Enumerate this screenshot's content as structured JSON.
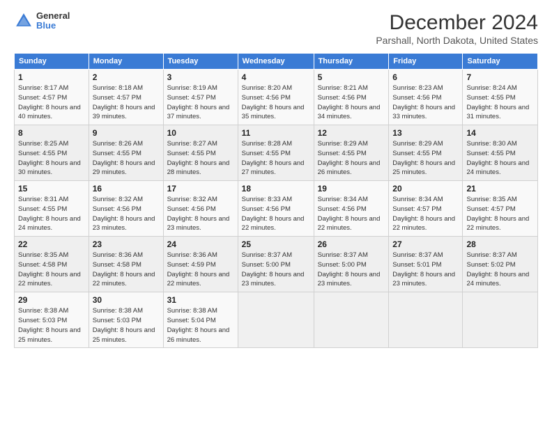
{
  "header": {
    "logo_general": "General",
    "logo_blue": "Blue",
    "month_title": "December 2024",
    "location": "Parshall, North Dakota, United States"
  },
  "weekdays": [
    "Sunday",
    "Monday",
    "Tuesday",
    "Wednesday",
    "Thursday",
    "Friday",
    "Saturday"
  ],
  "weeks": [
    [
      {
        "day": "1",
        "sunrise": "8:17 AM",
        "sunset": "4:57 PM",
        "daylight": "8 hours and 40 minutes."
      },
      {
        "day": "2",
        "sunrise": "8:18 AM",
        "sunset": "4:57 PM",
        "daylight": "8 hours and 39 minutes."
      },
      {
        "day": "3",
        "sunrise": "8:19 AM",
        "sunset": "4:57 PM",
        "daylight": "8 hours and 37 minutes."
      },
      {
        "day": "4",
        "sunrise": "8:20 AM",
        "sunset": "4:56 PM",
        "daylight": "8 hours and 35 minutes."
      },
      {
        "day": "5",
        "sunrise": "8:21 AM",
        "sunset": "4:56 PM",
        "daylight": "8 hours and 34 minutes."
      },
      {
        "day": "6",
        "sunrise": "8:23 AM",
        "sunset": "4:56 PM",
        "daylight": "8 hours and 33 minutes."
      },
      {
        "day": "7",
        "sunrise": "8:24 AM",
        "sunset": "4:55 PM",
        "daylight": "8 hours and 31 minutes."
      }
    ],
    [
      {
        "day": "8",
        "sunrise": "8:25 AM",
        "sunset": "4:55 PM",
        "daylight": "8 hours and 30 minutes."
      },
      {
        "day": "9",
        "sunrise": "8:26 AM",
        "sunset": "4:55 PM",
        "daylight": "8 hours and 29 minutes."
      },
      {
        "day": "10",
        "sunrise": "8:27 AM",
        "sunset": "4:55 PM",
        "daylight": "8 hours and 28 minutes."
      },
      {
        "day": "11",
        "sunrise": "8:28 AM",
        "sunset": "4:55 PM",
        "daylight": "8 hours and 27 minutes."
      },
      {
        "day": "12",
        "sunrise": "8:29 AM",
        "sunset": "4:55 PM",
        "daylight": "8 hours and 26 minutes."
      },
      {
        "day": "13",
        "sunrise": "8:29 AM",
        "sunset": "4:55 PM",
        "daylight": "8 hours and 25 minutes."
      },
      {
        "day": "14",
        "sunrise": "8:30 AM",
        "sunset": "4:55 PM",
        "daylight": "8 hours and 24 minutes."
      }
    ],
    [
      {
        "day": "15",
        "sunrise": "8:31 AM",
        "sunset": "4:55 PM",
        "daylight": "8 hours and 24 minutes."
      },
      {
        "day": "16",
        "sunrise": "8:32 AM",
        "sunset": "4:56 PM",
        "daylight": "8 hours and 23 minutes."
      },
      {
        "day": "17",
        "sunrise": "8:32 AM",
        "sunset": "4:56 PM",
        "daylight": "8 hours and 23 minutes."
      },
      {
        "day": "18",
        "sunrise": "8:33 AM",
        "sunset": "4:56 PM",
        "daylight": "8 hours and 22 minutes."
      },
      {
        "day": "19",
        "sunrise": "8:34 AM",
        "sunset": "4:56 PM",
        "daylight": "8 hours and 22 minutes."
      },
      {
        "day": "20",
        "sunrise": "8:34 AM",
        "sunset": "4:57 PM",
        "daylight": "8 hours and 22 minutes."
      },
      {
        "day": "21",
        "sunrise": "8:35 AM",
        "sunset": "4:57 PM",
        "daylight": "8 hours and 22 minutes."
      }
    ],
    [
      {
        "day": "22",
        "sunrise": "8:35 AM",
        "sunset": "4:58 PM",
        "daylight": "8 hours and 22 minutes."
      },
      {
        "day": "23",
        "sunrise": "8:36 AM",
        "sunset": "4:58 PM",
        "daylight": "8 hours and 22 minutes."
      },
      {
        "day": "24",
        "sunrise": "8:36 AM",
        "sunset": "4:59 PM",
        "daylight": "8 hours and 22 minutes."
      },
      {
        "day": "25",
        "sunrise": "8:37 AM",
        "sunset": "5:00 PM",
        "daylight": "8 hours and 23 minutes."
      },
      {
        "day": "26",
        "sunrise": "8:37 AM",
        "sunset": "5:00 PM",
        "daylight": "8 hours and 23 minutes."
      },
      {
        "day": "27",
        "sunrise": "8:37 AM",
        "sunset": "5:01 PM",
        "daylight": "8 hours and 23 minutes."
      },
      {
        "day": "28",
        "sunrise": "8:37 AM",
        "sunset": "5:02 PM",
        "daylight": "8 hours and 24 minutes."
      }
    ],
    [
      {
        "day": "29",
        "sunrise": "8:38 AM",
        "sunset": "5:03 PM",
        "daylight": "8 hours and 25 minutes."
      },
      {
        "day": "30",
        "sunrise": "8:38 AM",
        "sunset": "5:03 PM",
        "daylight": "8 hours and 25 minutes."
      },
      {
        "day": "31",
        "sunrise": "8:38 AM",
        "sunset": "5:04 PM",
        "daylight": "8 hours and 26 minutes."
      },
      null,
      null,
      null,
      null
    ]
  ],
  "labels": {
    "sunrise": "Sunrise:",
    "sunset": "Sunset:",
    "daylight": "Daylight:"
  }
}
